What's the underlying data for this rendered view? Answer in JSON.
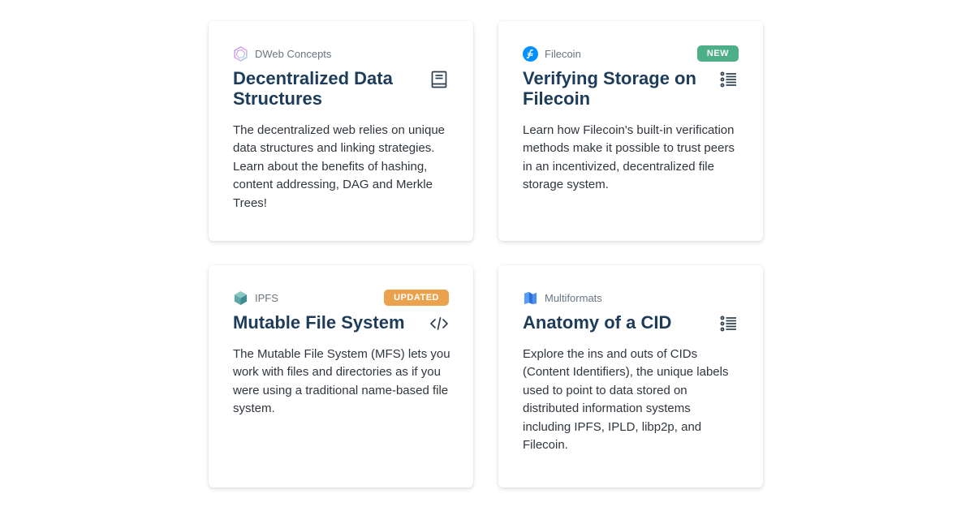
{
  "cards": [
    {
      "course": "DWeb Concepts",
      "course_icon": "dweb-concepts-icon",
      "title": "Decentralized Data Structures",
      "type_icon": "book-icon",
      "badge": "",
      "description": "The decentralized web relies on unique data structures and linking strategies. Learn about the benefits of hashing, content addressing, DAG and Merkle Trees!"
    },
    {
      "course": "Filecoin",
      "course_icon": "filecoin-icon",
      "title": "Verifying Storage on Filecoin",
      "type_icon": "list-icon",
      "badge": "NEW",
      "badge_color": "#4caf88",
      "description": "Learn how Filecoin's built-in verification methods make it possible to trust peers in an incentivized, decentralized file storage system."
    },
    {
      "course": "IPFS",
      "course_icon": "ipfs-cube-icon",
      "title": "Mutable File System",
      "type_icon": "code-icon",
      "badge": "UPDATED",
      "badge_color": "#eaa24f",
      "description": "The Mutable File System (MFS) lets you work with files and directories as if you were using a traditional name-based file system."
    },
    {
      "course": "Multiformats",
      "course_icon": "multiformats-icon",
      "title": "Anatomy of a CID",
      "type_icon": "list-icon",
      "badge": "",
      "description": "Explore the ins and outs of CIDs (Content Identifiers), the unique labels used to point to data stored on distributed information systems including IPFS, IPLD, libp2p, and Filecoin."
    }
  ],
  "colors": {
    "title": "#1d3c5a",
    "course_label": "#6b7580",
    "body_text": "#30363d",
    "filecoin_blue": "#0090ff",
    "ipfs_teal": "#5fa8a8",
    "multiformats_blue": "#3b82f6"
  }
}
